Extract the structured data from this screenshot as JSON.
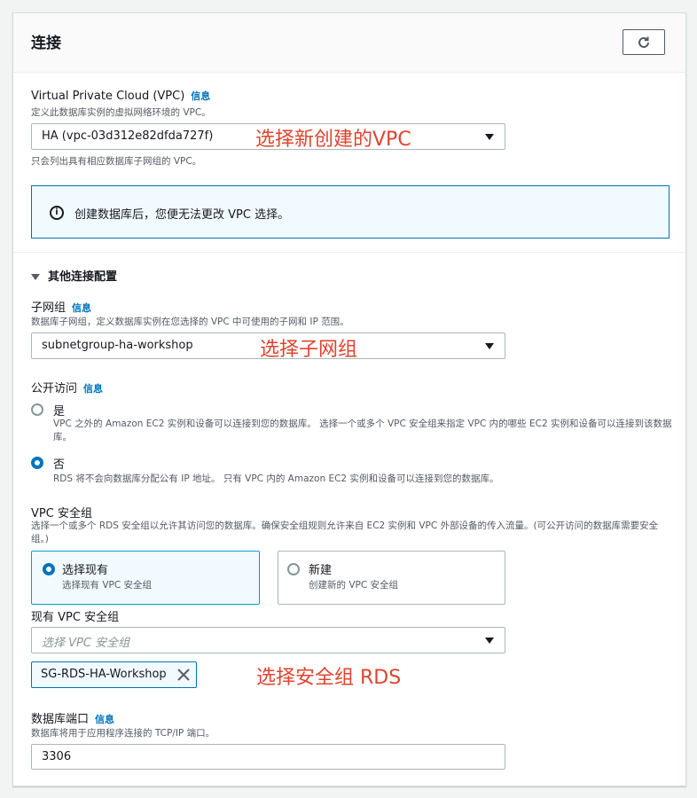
{
  "panel": {
    "title": "连接",
    "refresh_icon": "refresh-icon"
  },
  "vpc": {
    "label": "Virtual Private Cloud (VPC)",
    "info": "信息",
    "description": "定义此数据库实例的虚拟网络环境的 VPC。",
    "selected": "HA (vpc-03d312e82dfda727f)",
    "note": "只会列出具有相应数据库子网组的 VPC。",
    "annotation": "选择新创建的VPC"
  },
  "alert": {
    "icon": "info-icon",
    "text": "创建数据库后，您便无法更改 VPC 选择。"
  },
  "additional": {
    "title": "其他连接配置"
  },
  "subnet": {
    "label": "子网组",
    "info": "信息",
    "description": "数据库子网组，定义数据库实例在您选择的 VPC 中可使用的子网和 IP 范围。",
    "selected": "subnetgroup-ha-workshop",
    "annotation": "选择子网组"
  },
  "public_access": {
    "label": "公开访问",
    "info": "信息",
    "yes_label": "是",
    "yes_desc": "VPC 之外的 Amazon EC2 实例和设备可以连接到您的数据库。 选择一个或多个 VPC 安全组来指定 VPC 内的哪些 EC2 实例和设备可以连接到该数据库。",
    "no_label": "否",
    "no_desc": "RDS 将不会向数据库分配公有 IP 地址。 只有 VPC 内的 Amazon EC2 实例和设备可以连接到您的数据库。",
    "selected": "否"
  },
  "security_group": {
    "label": "VPC 安全组",
    "description": "选择一个或多个 RDS 安全组以允许其访问您的数据库。确保安全组规则允许来自 EC2 实例和 VPC 外部设备的传入流量。(可公开访问的数据库需要安全组。)",
    "existing_title": "选择现有",
    "existing_desc": "选择现有 VPC 安全组",
    "new_title": "新建",
    "new_desc": "创建新的 VPC 安全组",
    "selected_option": "选择现有"
  },
  "existing_sg": {
    "label": "现有 VPC 安全组",
    "placeholder": "选择 VPC 安全组",
    "token": "SG-RDS-HA-Workshop",
    "annotation": "选择安全组 RDS"
  },
  "port": {
    "label": "数据库端口",
    "info": "信息",
    "description": "数据库将用于应用程序连接的 TCP/IP 端口。",
    "value": "3306"
  },
  "colors": {
    "accent": "#0073bb",
    "annotation": "#e0432f"
  }
}
